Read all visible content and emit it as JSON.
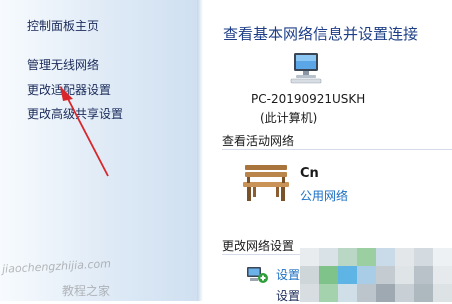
{
  "sidebar": {
    "items": [
      {
        "label": "控制面板主页"
      },
      {
        "label": "管理无线网络"
      },
      {
        "label": "更改适配器设置"
      },
      {
        "label": "更改高级共享设置"
      }
    ]
  },
  "main": {
    "title": "查看基本网络信息并设置连接",
    "computer": {
      "name": "PC-20190921USKH",
      "subtitle": "(此计算机)"
    },
    "active_networks": {
      "heading": "查看活动网络",
      "network_name": "Cn",
      "network_type": "公用网络"
    },
    "change_settings": {
      "heading": "更改网络设置",
      "link1": "设置",
      "link2": "设置"
    }
  },
  "watermark": {
    "url_text": "jiaochengzhijia.com",
    "site_text": "教程之家"
  },
  "colors": {
    "annotation_arrow": "#d9262a",
    "link": "#1b6fc4",
    "title": "#1e3f87"
  }
}
